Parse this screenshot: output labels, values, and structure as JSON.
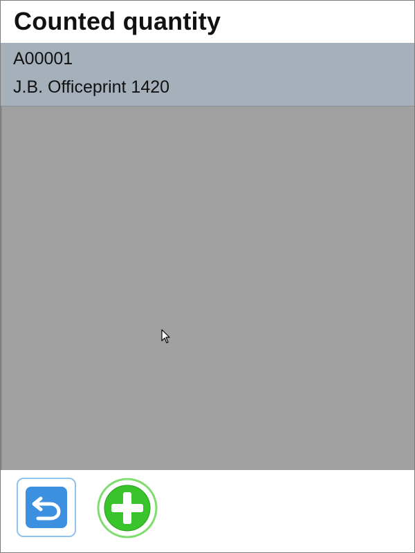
{
  "header": {
    "title": "Counted quantity"
  },
  "item": {
    "code": "A00001",
    "name": "J.B. Officeprint 1420"
  },
  "toolbar": {
    "back_icon": "return-arrow-icon",
    "add_icon": "plus-icon"
  },
  "colors": {
    "info_panel": "#a5b0ba",
    "content_area": "#a1a1a1",
    "back_button": "#3d8fe0",
    "add_button": "#39c42c"
  }
}
